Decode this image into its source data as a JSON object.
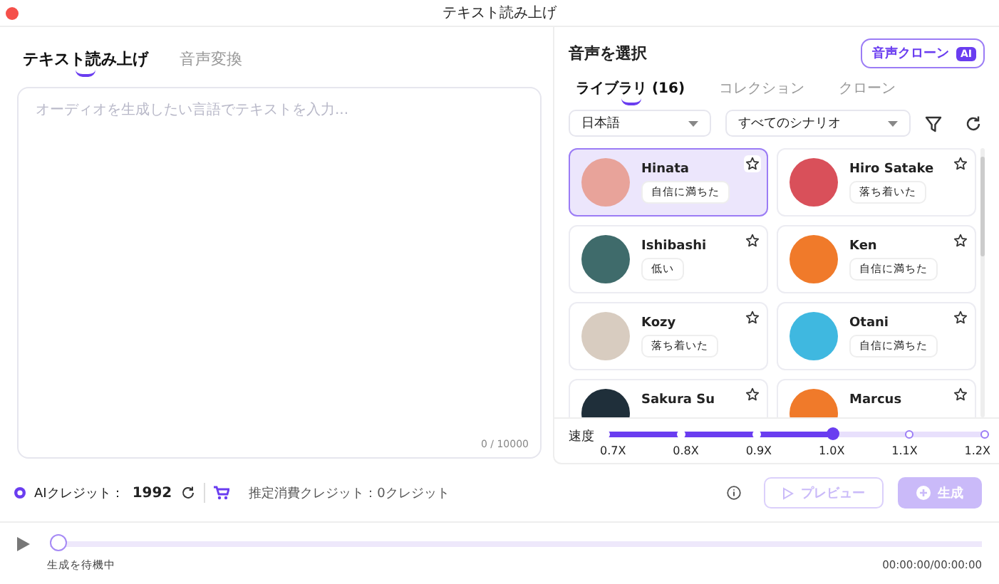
{
  "window": {
    "title": "テキスト読み上げ"
  },
  "editor": {
    "tabs": [
      {
        "label": "テキスト読み上げ",
        "selected": true
      },
      {
        "label": "音声変換",
        "selected": false
      }
    ],
    "placeholder": "オーディオを生成したい言語でテキストを入力...",
    "counter": "0 / 10000"
  },
  "voice_panel": {
    "title": "音声を選択",
    "clone_button": {
      "label": "音声クローン",
      "badge": "AI"
    },
    "tabs": [
      {
        "label": "ライブラリ (16)",
        "selected": true
      },
      {
        "label": "コレクション",
        "selected": false
      },
      {
        "label": "クローン",
        "selected": false
      }
    ],
    "filters": [
      {
        "value": "日本語"
      },
      {
        "value": "すべてのシナリオ"
      }
    ],
    "voices": [
      {
        "name": "Hinata",
        "tag": "自信に満ちた",
        "selected": true,
        "color": "#e8a39a"
      },
      {
        "name": "Hiro Satake",
        "tag": "落ち着いた",
        "selected": false,
        "color": "#d9505a"
      },
      {
        "name": "Ishibashi",
        "tag": "低い",
        "selected": false,
        "color": "#3f6b6b"
      },
      {
        "name": "Ken",
        "tag": "自信に満ちた",
        "selected": false,
        "color": "#f07a2a"
      },
      {
        "name": "Kozy",
        "tag": "落ち着いた",
        "selected": false,
        "color": "#d8ccc0"
      },
      {
        "name": "Otani",
        "tag": "自信に満ちた",
        "selected": false,
        "color": "#3fb8e0"
      },
      {
        "name": "Sakura Su",
        "selected": false,
        "color": "#1f2f3a"
      },
      {
        "name": "Marcus",
        "selected": false,
        "color": "#f07a2a"
      }
    ],
    "speed": {
      "label": "速度",
      "level": 0.6,
      "ticks": [
        "0.7X",
        "0.8X",
        "0.9X",
        "1.0X",
        "1.1X",
        "1.2X"
      ]
    }
  },
  "credits": {
    "label": "AIクレジット：",
    "value": "1992",
    "estimate": "推定消費クレジット：0クレジット"
  },
  "actions": [
    {
      "kind": "preview",
      "label": "プレビュー",
      "disabled": true
    },
    {
      "kind": "generate",
      "label": "生成",
      "disabled": true
    }
  ],
  "player": {
    "level": 0,
    "status": "生成を待機中",
    "time": "00:00:00/00:00:00"
  }
}
